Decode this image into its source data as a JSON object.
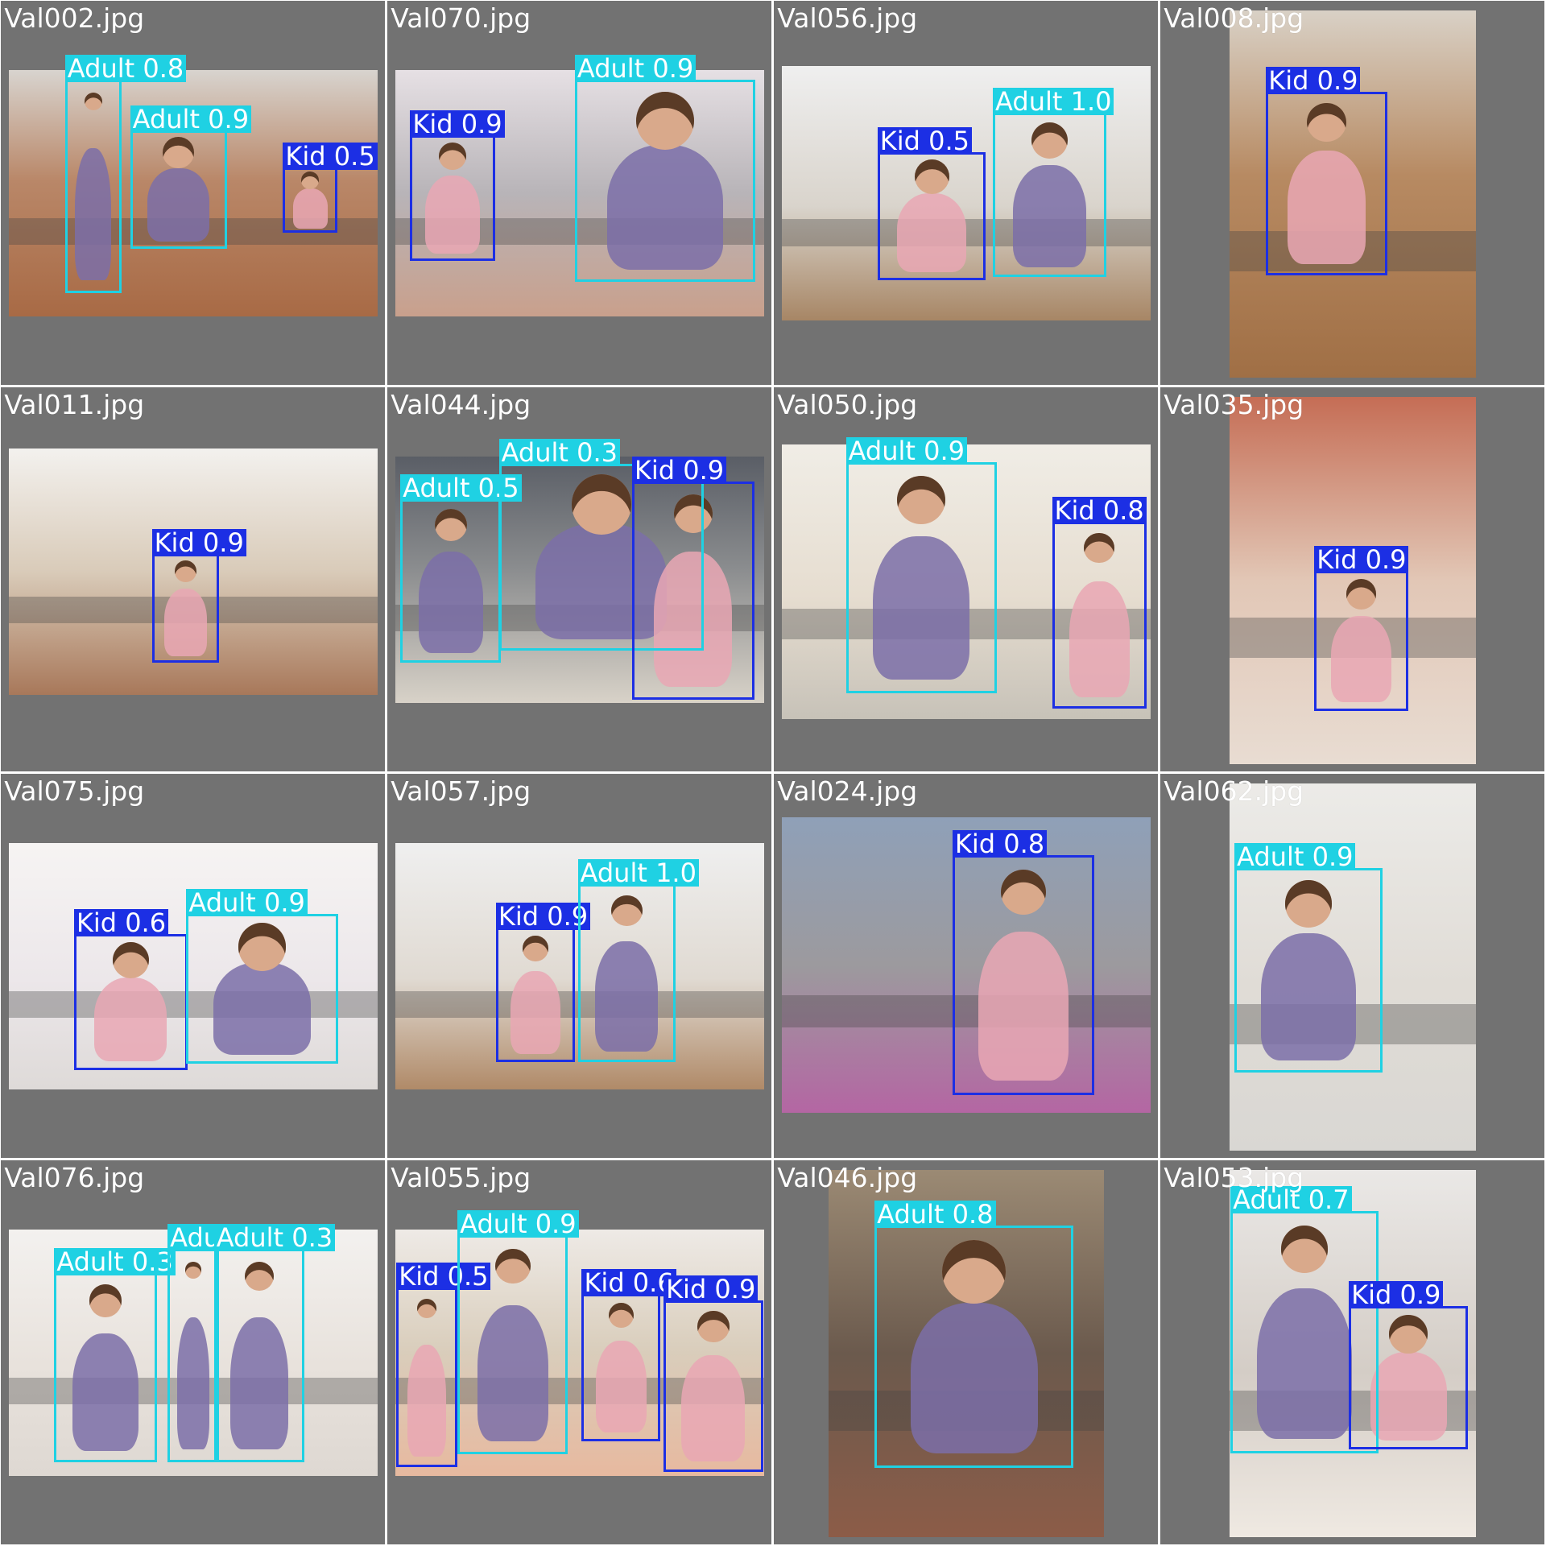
{
  "colors": {
    "kid": "#1c2fe4",
    "adult": "#1fd1e3",
    "cell_bg": "#727272"
  },
  "cells": [
    {
      "title": "Val002.jpg",
      "detections": [
        {
          "label": "Adult 0.8",
          "cls": "adult"
        },
        {
          "label": "Adult 0.9",
          "cls": "adult"
        },
        {
          "label": "Kid 0.5",
          "cls": "kid"
        }
      ]
    },
    {
      "title": "Val070.jpg",
      "detections": [
        {
          "label": "Kid 0.9",
          "cls": "kid"
        },
        {
          "label": "Adult 0.9",
          "cls": "adult"
        }
      ]
    },
    {
      "title": "Val056.jpg",
      "detections": [
        {
          "label": "Kid 0.5",
          "cls": "kid"
        },
        {
          "label": "Adult 1.0",
          "cls": "adult"
        }
      ]
    },
    {
      "title": "Val008.jpg",
      "detections": [
        {
          "label": "Kid 0.9",
          "cls": "kid"
        }
      ]
    },
    {
      "title": "Val011.jpg",
      "detections": [
        {
          "label": "Kid 0.9",
          "cls": "kid"
        }
      ]
    },
    {
      "title": "Val044.jpg",
      "detections": [
        {
          "label": "Adult 0.5",
          "cls": "adult"
        },
        {
          "label": "Adult 0.3",
          "cls": "adult"
        },
        {
          "label": "Kid 0.9",
          "cls": "kid"
        }
      ]
    },
    {
      "title": "Val050.jpg",
      "detections": [
        {
          "label": "Adult 0.9",
          "cls": "adult"
        },
        {
          "label": "Kid 0.8",
          "cls": "kid"
        }
      ]
    },
    {
      "title": "Val035.jpg",
      "detections": [
        {
          "label": "Kid 0.9",
          "cls": "kid"
        }
      ]
    },
    {
      "title": "Val075.jpg",
      "detections": [
        {
          "label": "Kid 0.6",
          "cls": "kid"
        },
        {
          "label": "Adult 0.9",
          "cls": "adult"
        }
      ]
    },
    {
      "title": "Val057.jpg",
      "detections": [
        {
          "label": "Kid 0.9",
          "cls": "kid"
        },
        {
          "label": "Adult 1.0",
          "cls": "adult"
        }
      ]
    },
    {
      "title": "Val024.jpg",
      "detections": [
        {
          "label": "Kid 0.8",
          "cls": "kid"
        }
      ]
    },
    {
      "title": "Val062.jpg",
      "detections": [
        {
          "label": "Adult 0.9",
          "cls": "adult"
        }
      ]
    },
    {
      "title": "Val076.jpg",
      "detections": [
        {
          "label": "Adult 0.3",
          "cls": "adult"
        },
        {
          "label": "Adult 0.3",
          "cls": "adult"
        },
        {
          "label": "Adult 0.3",
          "cls": "adult"
        }
      ]
    },
    {
      "title": "Val055.jpg",
      "detections": [
        {
          "label": "Kid 0.5",
          "cls": "kid"
        },
        {
          "label": "Adult 0.9",
          "cls": "adult"
        },
        {
          "label": "Kid 0.6",
          "cls": "kid"
        },
        {
          "label": "Kid 0.9",
          "cls": "kid"
        }
      ]
    },
    {
      "title": "Val046.jpg",
      "detections": [
        {
          "label": "Adult 0.8",
          "cls": "adult"
        }
      ]
    },
    {
      "title": "Val053.jpg",
      "detections": [
        {
          "label": "Adult 0.7",
          "cls": "adult"
        },
        {
          "label": "Kid 0.9",
          "cls": "kid"
        }
      ]
    }
  ]
}
